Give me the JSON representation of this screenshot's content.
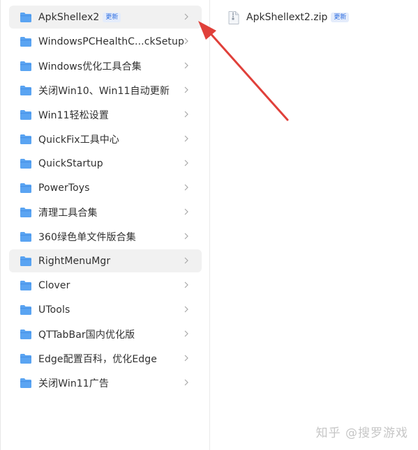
{
  "colors": {
    "folder_blue": "#5aa4f2",
    "folder_blue_dark": "#3b87df",
    "accent": "#2f6fe0",
    "arrow_red": "#e0403a",
    "active_row_bg": "#f1f1f1"
  },
  "sidebar": {
    "items": [
      {
        "label": "ApkShellex2",
        "badge": "更新",
        "icon": "folder-icon"
      },
      {
        "label": "WindowsPCHealthC...ckSetup",
        "icon": "folder-icon"
      },
      {
        "label": "Windows优化工具合集",
        "icon": "folder-icon"
      },
      {
        "label": "关闭Win10、Win11自动更新",
        "icon": "folder-icon"
      },
      {
        "label": "Win11轻松设置",
        "icon": "folder-icon"
      },
      {
        "label": "QuickFix工具中心",
        "icon": "folder-icon"
      },
      {
        "label": "QuickStartup",
        "icon": "folder-icon"
      },
      {
        "label": "PowerToys",
        "icon": "folder-icon"
      },
      {
        "label": "清理工具合集",
        "icon": "folder-icon"
      },
      {
        "label": "360绿色单文件版合集",
        "icon": "folder-icon"
      },
      {
        "label": "RightMenuMgr",
        "icon": "folder-icon"
      },
      {
        "label": "Clover",
        "icon": "folder-icon"
      },
      {
        "label": "UTools",
        "icon": "folder-icon"
      },
      {
        "label": "QTTabBar国内优化版",
        "icon": "folder-icon"
      },
      {
        "label": "Edge配置百科，优化Edge",
        "icon": "folder-icon"
      },
      {
        "label": "关闭Win11广告",
        "icon": "folder-icon"
      }
    ]
  },
  "files": [
    {
      "label": "ApkShellext2.zip",
      "badge": "更新",
      "icon": "zip-file-icon"
    }
  ],
  "watermark": "知乎 @搜罗游戏"
}
